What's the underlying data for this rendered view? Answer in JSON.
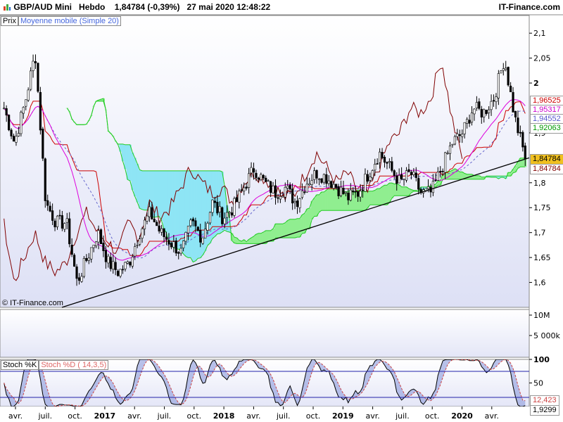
{
  "header": {
    "symbol": "GBP/AUD Mini",
    "period": "Hebdo",
    "quote": "1,84784 (-0,39%)",
    "datetime": "27 mai 2020 12:48:22",
    "brand": "IT-Finance.com"
  },
  "price_panel": {
    "legend_price": "Prix",
    "legend_ma": "Moyenne mobile (Simple 20)",
    "watermark": "© IT-Finance.com",
    "axis_labels": [
      "2,1",
      "2,05",
      "2",
      "1,9",
      "1,8",
      "1,75",
      "1,7",
      "1,65",
      "1,6"
    ],
    "value_tags": [
      {
        "text": "1,96525",
        "color": "#cc0000"
      },
      {
        "text": "1,95317",
        "color": "#cc00cc"
      },
      {
        "text": "1,94552",
        "color": "#5555cc"
      },
      {
        "text": "1,92063",
        "color": "#009900"
      },
      {
        "text": "1,84784",
        "color": "#000000"
      },
      {
        "text": "1,84784",
        "color": "#800000"
      }
    ],
    "colors": {
      "candle_up": "#ffffff",
      "candle_down": "#000000",
      "cloud_bull": "#90ee90",
      "cloud_bear": "#8ee5f5",
      "tenkan": "#cc0000",
      "chikou": "#800000",
      "ma": "#dd00dd",
      "ma_dashed": "#6666cc",
      "trendline": "#000000"
    }
  },
  "volume_panel": {
    "axis_labels": [
      "10M",
      "5 000k"
    ]
  },
  "stoch_panel": {
    "legend_k": "Stoch %K",
    "legend_d": "Stoch %D ( 14,3,5)",
    "axis_labels": [
      "100",
      "50"
    ],
    "value_tags": [
      {
        "text": "12,423",
        "color": "#cc4444"
      },
      {
        "text": "1,9299",
        "color": "#000000"
      }
    ],
    "levels": [
      80,
      20
    ]
  },
  "x_axis": {
    "labels": [
      {
        "text": "avr.",
        "bold": false
      },
      {
        "text": "juil.",
        "bold": false
      },
      {
        "text": "oct.",
        "bold": false
      },
      {
        "text": "2017",
        "bold": true
      },
      {
        "text": "avr.",
        "bold": false
      },
      {
        "text": "juil.",
        "bold": false
      },
      {
        "text": "oct.",
        "bold": false
      },
      {
        "text": "2018",
        "bold": true
      },
      {
        "text": "avr.",
        "bold": false
      },
      {
        "text": "juil.",
        "bold": false
      },
      {
        "text": "oct.",
        "bold": false
      },
      {
        "text": "2019",
        "bold": true
      },
      {
        "text": "avr.",
        "bold": false
      },
      {
        "text": "juil.",
        "bold": false
      },
      {
        "text": "oct.",
        "bold": false
      },
      {
        "text": "2020",
        "bold": true
      },
      {
        "text": "avr.",
        "bold": false
      }
    ]
  },
  "chart_data": {
    "type": "line",
    "title": "GBP/AUD Mini",
    "frequency": "weekly",
    "y_range": [
      1.55,
      2.12
    ],
    "trendline": {
      "from": [
        1.55,
        "2016 start"
      ],
      "to": [
        1.85,
        "2020 end"
      ]
    },
    "close_series": [
      {
        "x": "2016-03",
        "y": 1.95
      },
      {
        "x": "2016-04",
        "y": 1.88
      },
      {
        "x": "2016-05",
        "y": 1.96
      },
      {
        "x": "2016-06",
        "y": 2.06
      },
      {
        "x": "2016-07",
        "y": 1.76
      },
      {
        "x": "2016-08",
        "y": 1.72
      },
      {
        "x": "2016-09",
        "y": 1.72
      },
      {
        "x": "2016-10",
        "y": 1.6
      },
      {
        "x": "2016-11",
        "y": 1.65
      },
      {
        "x": "2016-12",
        "y": 1.7
      },
      {
        "x": "2017-01",
        "y": 1.64
      },
      {
        "x": "2017-02",
        "y": 1.62
      },
      {
        "x": "2017-03",
        "y": 1.64
      },
      {
        "x": "2017-04",
        "y": 1.7
      },
      {
        "x": "2017-05",
        "y": 1.74
      },
      {
        "x": "2017-06",
        "y": 1.7
      },
      {
        "x": "2017-07",
        "y": 1.68
      },
      {
        "x": "2017-08",
        "y": 1.66
      },
      {
        "x": "2017-09",
        "y": 1.72
      },
      {
        "x": "2017-10",
        "y": 1.69
      },
      {
        "x": "2017-11",
        "y": 1.76
      },
      {
        "x": "2017-12",
        "y": 1.73
      },
      {
        "x": "2018-01",
        "y": 1.75
      },
      {
        "x": "2018-02",
        "y": 1.79
      },
      {
        "x": "2018-03",
        "y": 1.83
      },
      {
        "x": "2018-04",
        "y": 1.8
      },
      {
        "x": "2018-05",
        "y": 1.78
      },
      {
        "x": "2018-06",
        "y": 1.79
      },
      {
        "x": "2018-07",
        "y": 1.76
      },
      {
        "x": "2018-08",
        "y": 1.8
      },
      {
        "x": "2018-09",
        "y": 1.82
      },
      {
        "x": "2018-10",
        "y": 1.81
      },
      {
        "x": "2018-11",
        "y": 1.79
      },
      {
        "x": "2018-12",
        "y": 1.77
      },
      {
        "x": "2019-01",
        "y": 1.78
      },
      {
        "x": "2019-02",
        "y": 1.82
      },
      {
        "x": "2019-03",
        "y": 1.86
      },
      {
        "x": "2019-04",
        "y": 1.83
      },
      {
        "x": "2019-05",
        "y": 1.8
      },
      {
        "x": "2019-06",
        "y": 1.82
      },
      {
        "x": "2019-07",
        "y": 1.78
      },
      {
        "x": "2019-08",
        "y": 1.78
      },
      {
        "x": "2019-09",
        "y": 1.83
      },
      {
        "x": "2019-10",
        "y": 1.88
      },
      {
        "x": "2019-11",
        "y": 1.9
      },
      {
        "x": "2019-12",
        "y": 1.95
      },
      {
        "x": "2020-01",
        "y": 1.94
      },
      {
        "x": "2020-02",
        "y": 1.97
      },
      {
        "x": "2020-03",
        "y": 2.05
      },
      {
        "x": "2020-04",
        "y": 1.93
      },
      {
        "x": "2020-05",
        "y": 1.85
      }
    ],
    "last_values": {
      "price": 1.84784,
      "tenkan": 1.96525,
      "ma": 1.95317,
      "kijun": 1.94552,
      "senkou": 1.92063
    },
    "stochastic": {
      "k_last": 1.9299,
      "d_last": 12.423,
      "params": "14,3,5",
      "range": [
        0,
        100
      ]
    }
  }
}
